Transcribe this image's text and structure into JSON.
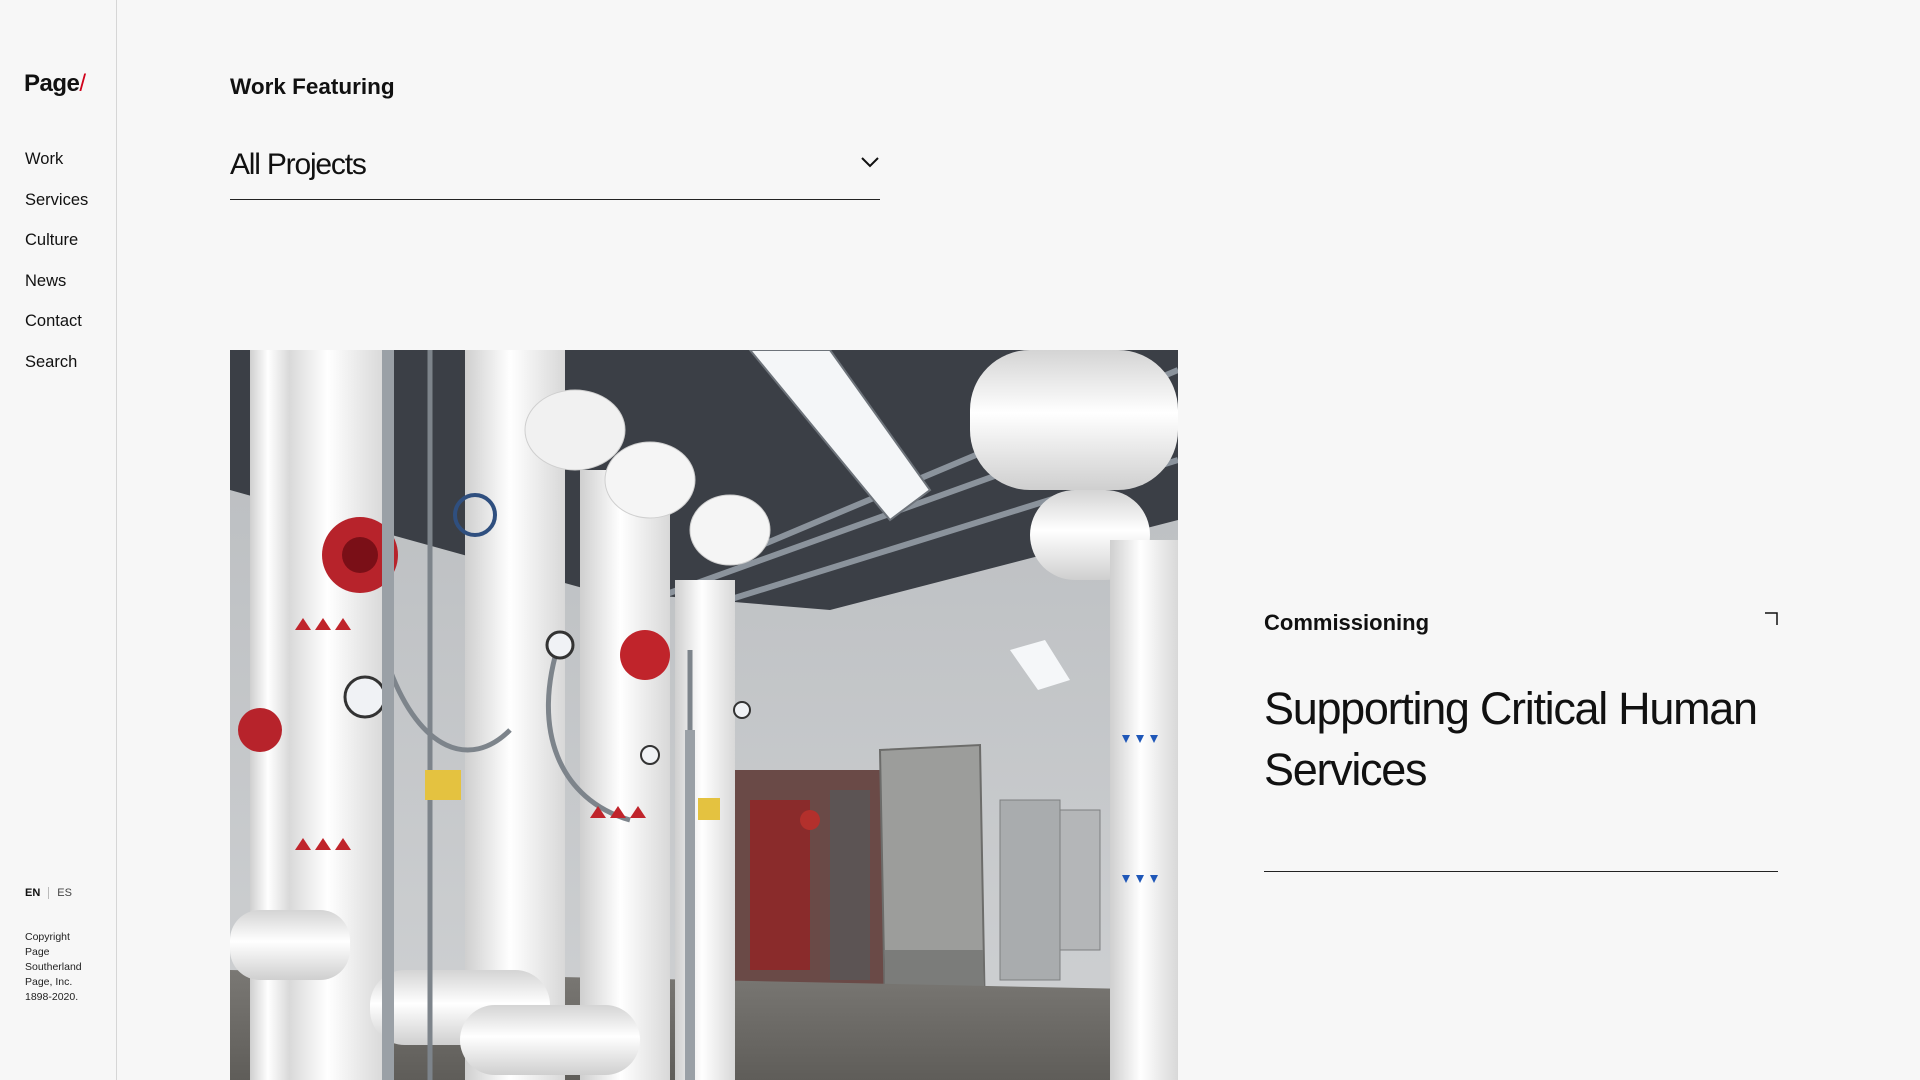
{
  "brand": {
    "logo_text": "Page",
    "logo_slash": "/",
    "accent_color": "#d0021b"
  },
  "nav": {
    "items": [
      {
        "label": "Work"
      },
      {
        "label": "Services"
      },
      {
        "label": "Culture"
      },
      {
        "label": "News"
      },
      {
        "label": "Contact"
      },
      {
        "label": "Search"
      }
    ]
  },
  "language": {
    "active": "EN",
    "other": "ES"
  },
  "footer": {
    "copyright": "Copyright Page Southerland Page, Inc. 1898-2020."
  },
  "filter": {
    "title": "Work Featuring",
    "selected": "All Projects",
    "icon": "chevron-down-icon"
  },
  "featured": {
    "category": "Commissioning",
    "title": "Supporting Critical Human Services",
    "image_subject": "mechanical-room-photo",
    "corner_icon": "corner-bracket-icon"
  }
}
